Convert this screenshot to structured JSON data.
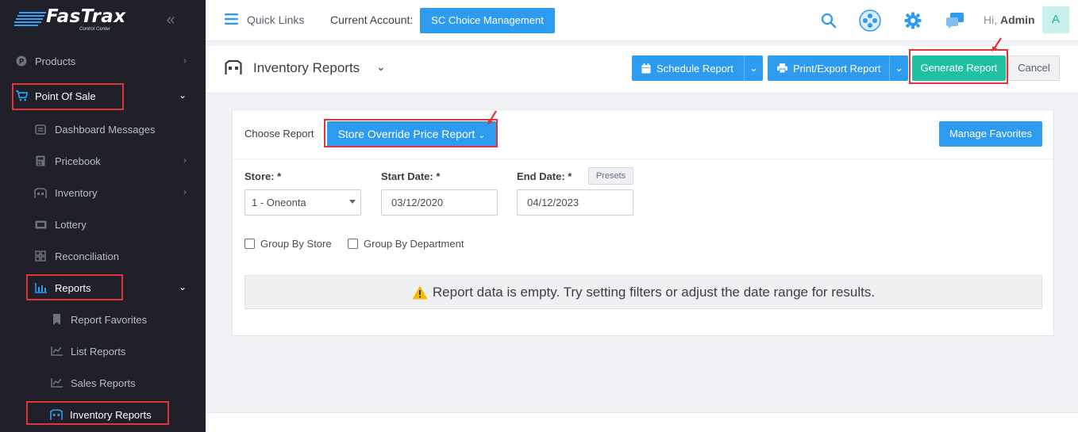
{
  "brand": {
    "name": "FasTrax",
    "tagline": "Control Center"
  },
  "sidebar": {
    "items": [
      {
        "label": "Products",
        "icon": "products-icon"
      },
      {
        "label": "Point Of Sale",
        "icon": "cart-icon"
      },
      {
        "label": "Dashboard Messages",
        "icon": "messages-icon"
      },
      {
        "label": "Pricebook",
        "icon": "calculator-icon"
      },
      {
        "label": "Inventory",
        "icon": "inventory-icon"
      },
      {
        "label": "Lottery",
        "icon": "ticket-icon"
      },
      {
        "label": "Reconciliation",
        "icon": "grid-icon"
      },
      {
        "label": "Reports",
        "icon": "bar-chart-icon"
      },
      {
        "label": "Report Favorites",
        "icon": "bookmark-icon"
      },
      {
        "label": "List Reports",
        "icon": "line-chart-icon"
      },
      {
        "label": "Sales Reports",
        "icon": "line-chart-icon"
      },
      {
        "label": "Inventory Reports",
        "icon": "inventory-icon"
      }
    ]
  },
  "topbar": {
    "quick_links": "Quick Links",
    "current_account_label": "Current Account:",
    "current_account": "SC Choice Management",
    "greeting_prefix": "Hi,",
    "user": "Admin",
    "avatar_initial": "A"
  },
  "titlebar": {
    "title": "Inventory Reports",
    "schedule": "Schedule Report",
    "print_export": "Print/Export Report",
    "generate": "Generate Report",
    "cancel": "Cancel"
  },
  "report": {
    "choose_label": "Choose Report",
    "selected": "Store Override Price Report",
    "manage_favorites": "Manage Favorites",
    "store_label": "Store: *",
    "store_value": "1 - Oneonta",
    "start_label": "Start Date: *",
    "start_value": "03/12/2020",
    "end_label": "End Date: *",
    "end_value": "04/12/2023",
    "presets": "Presets",
    "group_store": "Group By Store",
    "group_department": "Group By Department",
    "empty_message": "Report data is empty. Try setting filters or adjust the date range for results."
  },
  "colors": {
    "accent": "#2d9bf0",
    "success": "#20c1a3",
    "sidebar": "#1f2029",
    "highlight": "#e0333a"
  }
}
